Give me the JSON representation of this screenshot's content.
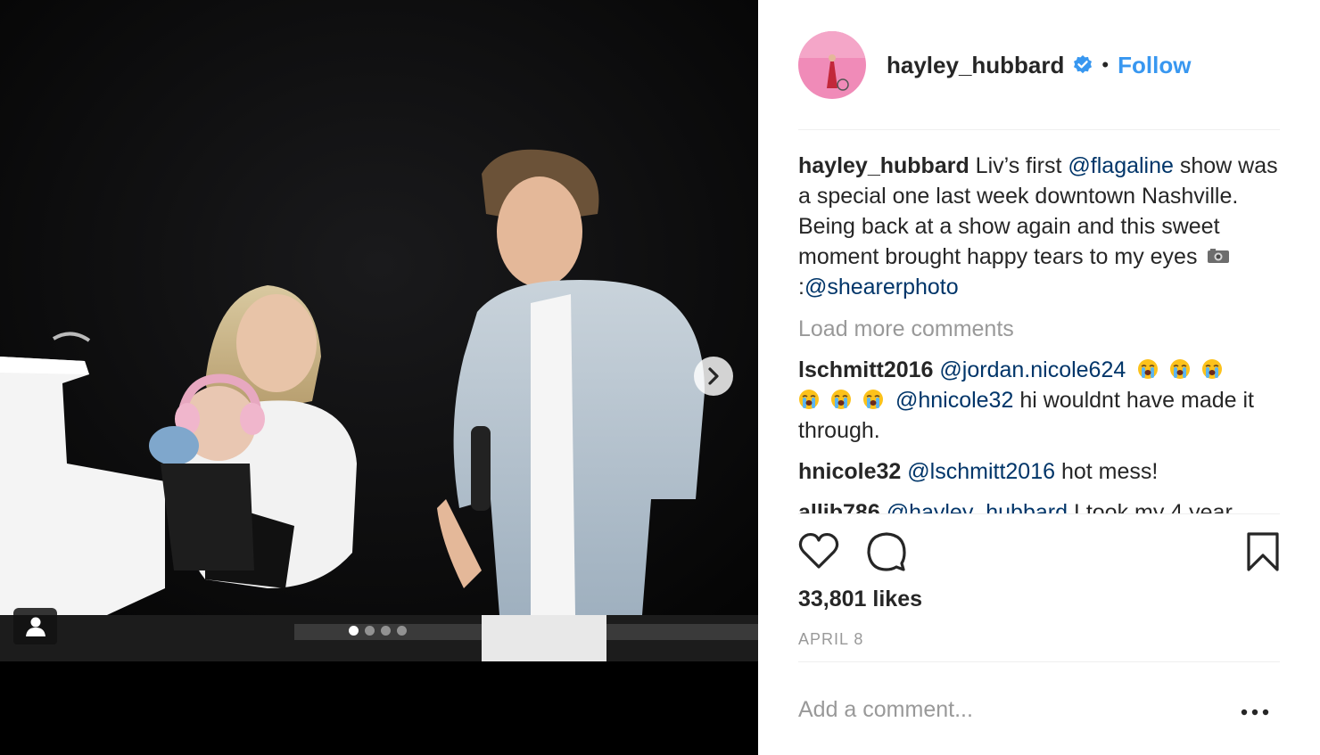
{
  "post": {
    "username": "hayley_hubbard",
    "verified": true,
    "follow_label": "Follow",
    "bullet": "•",
    "caption": {
      "username": "hayley_hubbard",
      "text_1": " Liv’s first ",
      "mention_1": "@flagaline",
      "text_2": " show was a special one last week downtown Nashville. Being back at a show again and this sweet moment brought happy tears to my eyes ",
      "text_3": " :",
      "mention_2": "@shearerphoto"
    },
    "load_more": "Load more comments",
    "comments": [
      {
        "username": "lschmitt2016",
        "mention_1": "@jordan.nicole624",
        "mention_2": "@hnicole32",
        "text": " hi wouldnt have made it through."
      },
      {
        "username": "hnicole32",
        "mention_1": "@lschmitt2016",
        "text": " hot mess!"
      },
      {
        "username": "allib786",
        "mention_1": "@hayley_hubbard",
        "text": " I took my 4 year"
      }
    ],
    "likes": "33,801 likes",
    "date": "APRIL 8",
    "add_comment_placeholder": "Add a comment...",
    "carousel": {
      "count": 4,
      "active": 0
    }
  },
  "icons": {
    "heart": "heart-icon",
    "comment": "comment-icon",
    "bookmark": "bookmark-icon",
    "next": "chevron-right-icon",
    "tag": "user-tag-icon",
    "verified": "verified-badge-icon",
    "more": "more-options-icon",
    "emoji": "loudly-crying-face-emoji",
    "camera": "camera-emoji"
  },
  "colors": {
    "follow": "#3897f0",
    "mention": "#003569",
    "muted": "#999999",
    "verified": "#3897f0"
  }
}
